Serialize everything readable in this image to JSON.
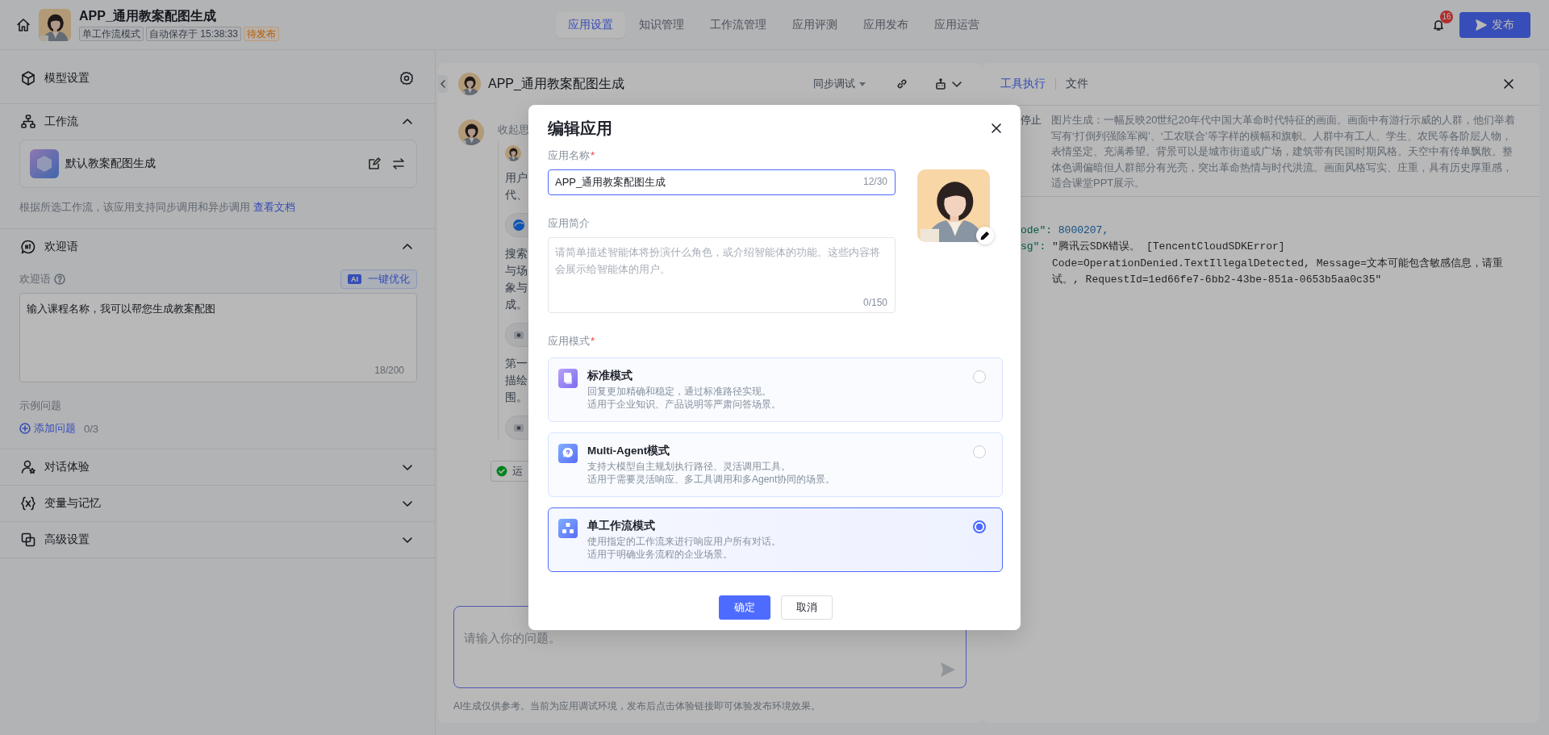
{
  "top_bar": {
    "title": "APP_通用教案配图生成",
    "tags": [
      {
        "text": "单工作流模式",
        "kind": "mode"
      },
      {
        "text": "自动保存于 15:38:33",
        "kind": "saved"
      },
      {
        "text": "待发布",
        "kind": "status"
      }
    ],
    "tabs": [
      {
        "label": "应用设置",
        "selected": true
      },
      {
        "label": "知识管理",
        "selected": false
      },
      {
        "label": "工作流管理",
        "selected": false
      },
      {
        "label": "应用评测",
        "selected": false
      },
      {
        "label": "应用发布",
        "selected": false
      },
      {
        "label": "应用运营",
        "selected": false
      }
    ],
    "notification_count": "16",
    "publish_button": "发布"
  },
  "left_panel": {
    "sections": [
      {
        "kind": "model",
        "title": "模型设置"
      },
      {
        "kind": "workflow",
        "title": "工作流",
        "expanded": true,
        "workflow_name": "默认教案配图生成",
        "note": "根据所选工作流，该应用支持同步调用和异步调用",
        "note_link": "查看文档"
      },
      {
        "kind": "welcome",
        "title": "欢迎语",
        "expanded": true,
        "field_label": "欢迎语",
        "optimize_badge": "AI",
        "optimize_button": "一键优化",
        "value": "输入课程名称，我可以帮您生成教案配图",
        "counter": "18/200",
        "examples_label": "示例问题",
        "add_button": "添加问题",
        "add_count": "0/3"
      },
      {
        "kind": "chat",
        "title": "对话体验",
        "expanded": false
      },
      {
        "kind": "variables",
        "title": "变量与记忆",
        "expanded": false
      },
      {
        "kind": "advanced",
        "title": "高级设置",
        "expanded": false
      }
    ]
  },
  "chat_panel": {
    "title": "APP_通用教案配图生成",
    "mode_select": "同步调试",
    "collapse_label": "收起思",
    "thread": [
      {
        "kind": "paragraph",
        "lines": [
          "用户",
          "代、"
        ]
      },
      {
        "kind": "search-pill"
      },
      {
        "kind": "paragraph",
        "lines": [
          "搜索",
          "与场",
          "象与",
          "成。"
        ]
      },
      {
        "kind": "tool-pill"
      },
      {
        "kind": "paragraph",
        "lines": [
          "第一",
          "描绘",
          "围。"
        ]
      },
      {
        "kind": "tool-pill"
      }
    ],
    "status_badge": "运",
    "input_placeholder": "请输入你的问题。",
    "disclaimer": "AI生成仅供参考。当前为应用调试环境，发布后点击体验链接即可体验发布环境效果。"
  },
  "tool_panel": {
    "tabs": [
      {
        "label": "工具执行",
        "selected": true
      },
      {
        "label": "文件",
        "selected": false
      }
    ],
    "status": "停止",
    "description": "图片生成：一幅反映20世纪20年代中国大革命时代特征的画面。画面中有游行示威的人群，他们举着写有‘打倒列强除军阀’、‘工农联合’等字样的横幅和旗帜。人群中有工人、学生、农民等各阶层人物，表情坚定、充满希望。背景可以是城市街道或广场，建筑带有民国时期风格。天空中有传单飘散。整体色调偏暗但人群部分有光亮，突出革命热情与时代洪流。画面风格写实、庄重，具有历史厚重感，适合课堂PPT展示。",
    "code_lines": [
      {
        "kind": "number-entry",
        "key": "ode\":",
        "value": "8000207,"
      },
      {
        "kind": "string-entry",
        "key": "sg\":",
        "value": "\"腾讯云SDK错误。 [TencentCloudSDKError]"
      },
      {
        "kind": "continuation",
        "value": "Code=OperationDenied.TextIllegalDetected, Message=文本可能包含敏感信息，请重"
      },
      {
        "kind": "continuation",
        "value": "试。, RequestId=1ed66fe7-6bb2-43be-851a-0653b5aa0c35\""
      }
    ]
  },
  "modal": {
    "title": "编辑应用",
    "name_label": {
      "text": "应用名称",
      "required_mark": "*"
    },
    "name_value": "APP_通用教案配图生成",
    "name_counter": "12/30",
    "intro_label": {
      "text": "应用简介"
    },
    "intro_placeholder": "请简单描述智能体将扮演什么角色，或介绍智能体的功能。这些内容将会展示给智能体的用户。",
    "intro_counter": "0/150",
    "mode_label": {
      "text": "应用模式",
      "required_mark": "*"
    },
    "modes": [
      {
        "kind": "standard",
        "title": "标准模式",
        "description": [
          "回复更加精确和稳定，通过标准路径实现。",
          "适用于企业知识、产品说明等严肃问答场景。"
        ],
        "selected": false
      },
      {
        "kind": "multi-agent",
        "title": "Multi-Agent模式",
        "description": [
          "支持大模型自主规划执行路径、灵活调用工具。",
          "适用于需要灵活响应、多工具调用和多Agent协同的场景。"
        ],
        "selected": false
      },
      {
        "kind": "workflow",
        "title": "单工作流模式",
        "description": [
          "使用指定的工作流来进行响应用户所有对话。",
          "适用于明确业务流程的企业场景。"
        ],
        "selected": true
      }
    ],
    "buttons": [
      {
        "label": "确定",
        "kind": "primary"
      },
      {
        "label": "取消",
        "kind": "secondary"
      }
    ]
  }
}
